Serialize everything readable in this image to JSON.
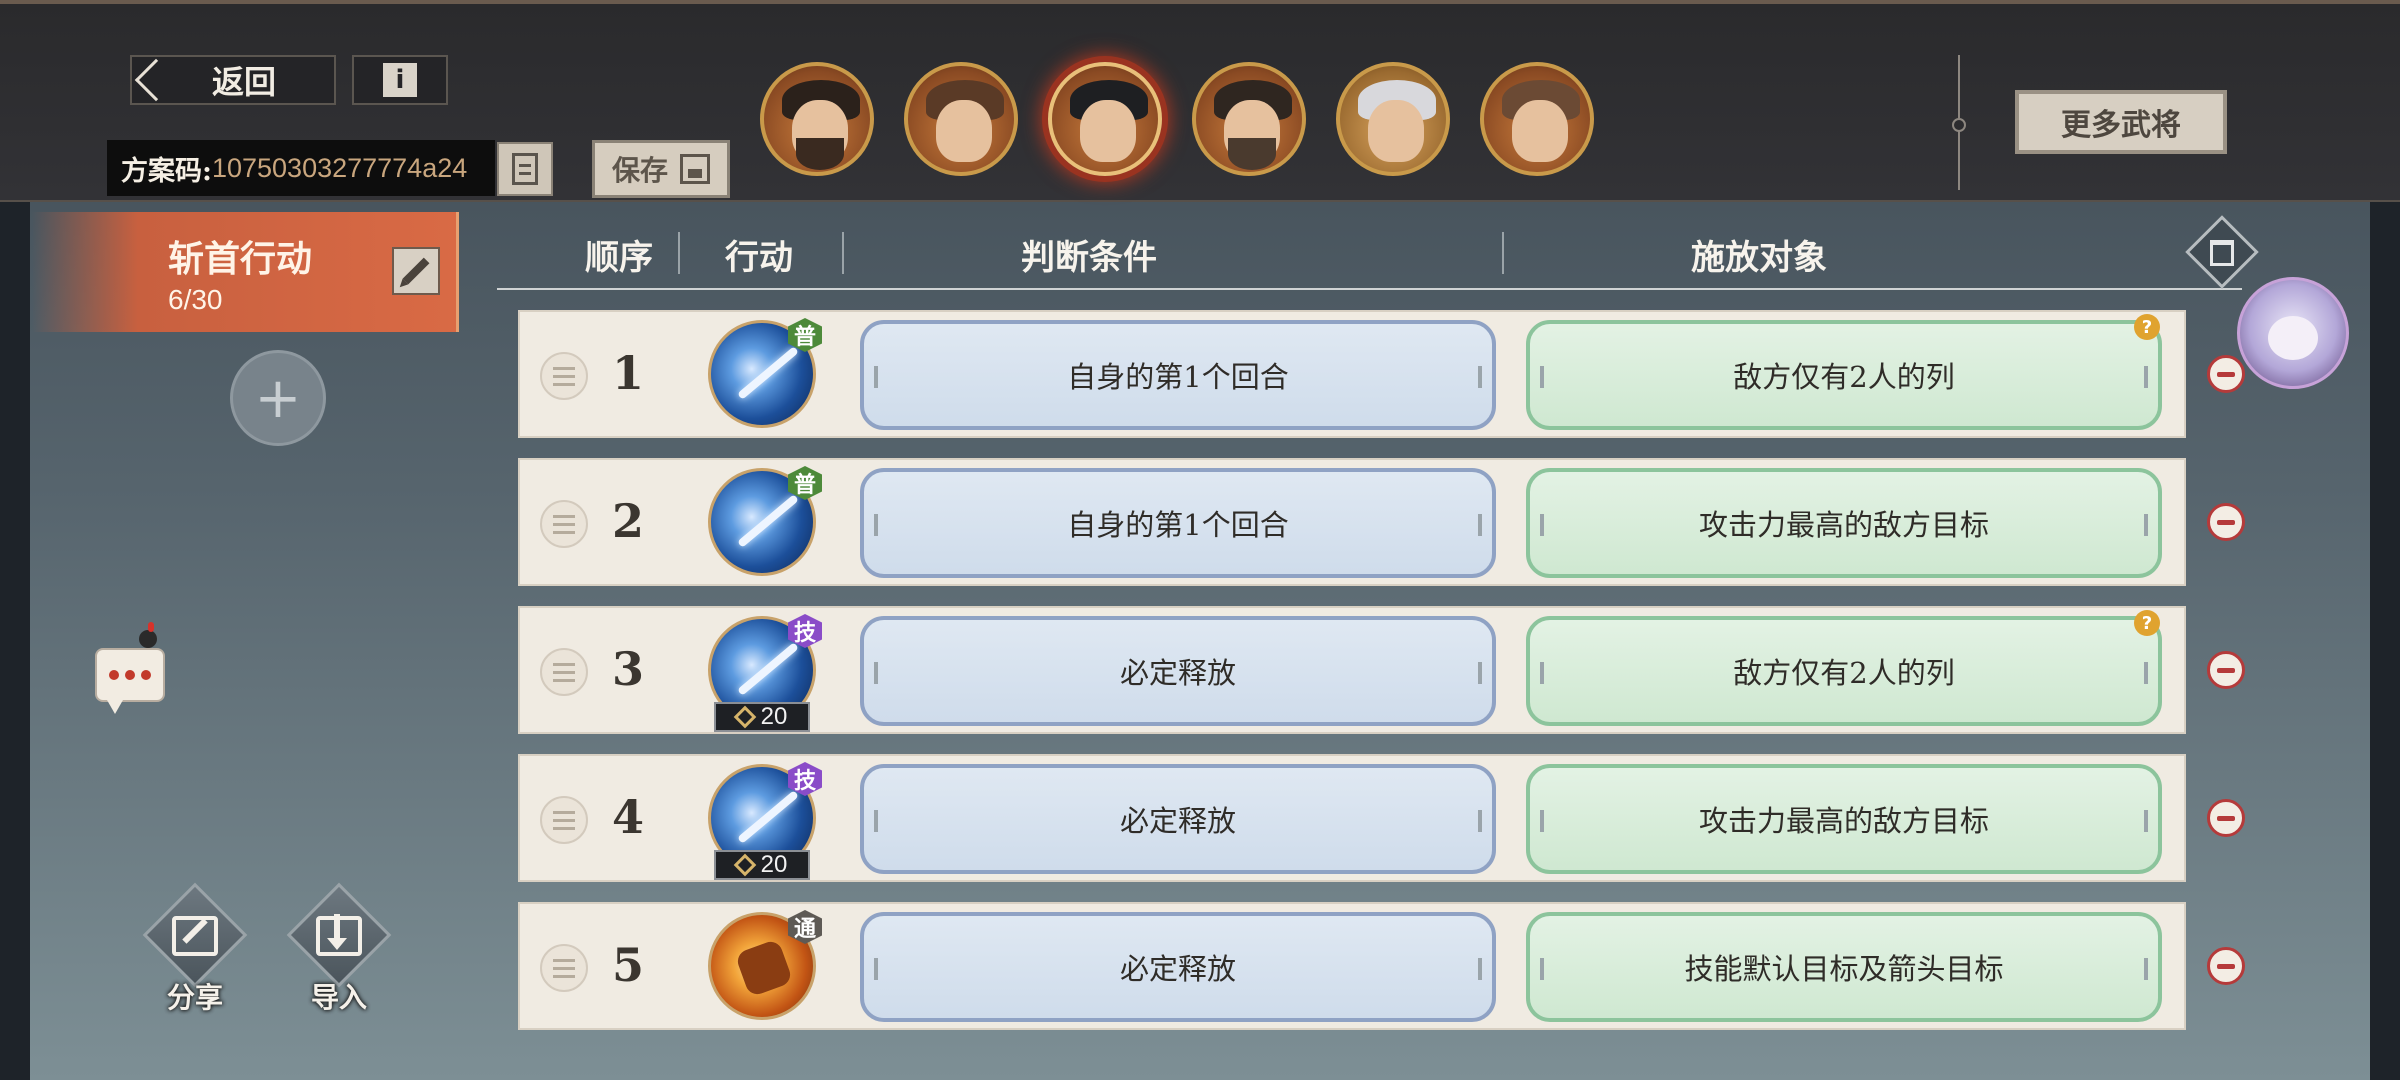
{
  "header": {
    "back_label": "返回",
    "info_label": "i",
    "scheme_code_label": "方案码:",
    "scheme_code_value": "10750303277774a24",
    "save_label": "保存",
    "more_heroes_label": "更多武将",
    "heroes": [
      {
        "name": "hero-1"
      },
      {
        "name": "hero-2"
      },
      {
        "name": "hero-3",
        "selected": true
      },
      {
        "name": "hero-4"
      },
      {
        "name": "hero-5"
      },
      {
        "name": "hero-6"
      }
    ]
  },
  "plan": {
    "name": "斩首行动",
    "count": "6/30",
    "add_label": "+"
  },
  "tools": {
    "share_label": "分享",
    "import_label": "导入"
  },
  "table": {
    "headers": {
      "order": "顺序",
      "action": "行动",
      "condition": "判断条件",
      "target": "施放对象"
    },
    "rows": [
      {
        "order": "1",
        "skill_type": "普",
        "cost": "",
        "condition": "自身的第1个回合",
        "target": "敌方仅有2人的列",
        "help": true
      },
      {
        "order": "2",
        "skill_type": "普",
        "cost": "",
        "condition": "自身的第1个回合",
        "target": "攻击力最高的敌方目标",
        "help": false
      },
      {
        "order": "3",
        "skill_type": "技",
        "cost": "20",
        "condition": "必定释放",
        "target": "敌方仅有2人的列",
        "help": true
      },
      {
        "order": "4",
        "skill_type": "技",
        "cost": "20",
        "condition": "必定释放",
        "target": "攻击力最高的敌方目标",
        "help": false
      },
      {
        "order": "5",
        "skill_type": "通",
        "cost": "",
        "condition": "必定释放",
        "target": "技能默认目标及箭头目标",
        "help": false
      }
    ],
    "help_glyph": "?"
  },
  "colors": {
    "accent": "#d96a45",
    "condition_border": "#8fa2c4",
    "target_border": "#8cc49c",
    "remove": "#b53a3a"
  }
}
